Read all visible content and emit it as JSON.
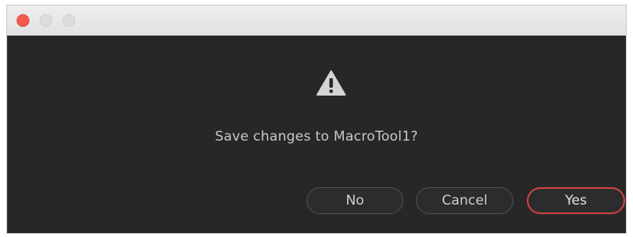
{
  "window": {
    "controls": {
      "close_icon": "close-dot-icon",
      "minimize_icon": "minimize-dot-icon",
      "zoom_icon": "zoom-dot-icon",
      "close_color": "#f25b4f"
    }
  },
  "dialog": {
    "icon": "warning-icon",
    "message": "Save changes to MacroTool1?",
    "buttons": {
      "no": "No",
      "cancel": "Cancel",
      "yes": "Yes"
    },
    "default_button_color": "#d1443c",
    "background_color": "#27272a"
  }
}
